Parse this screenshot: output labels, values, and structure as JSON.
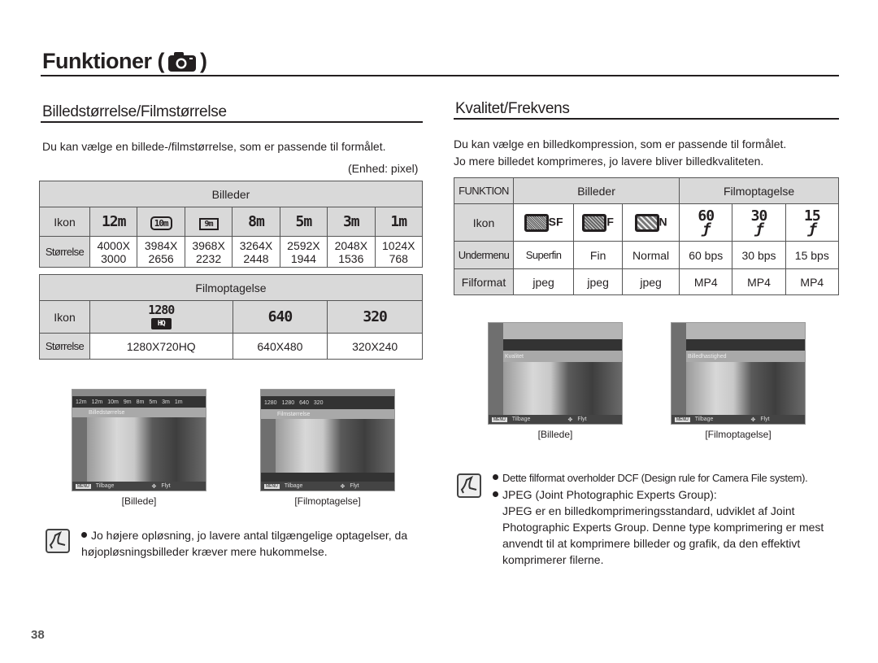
{
  "page": {
    "title": "Funktioner (",
    "title_close": ")",
    "title_icon": "camera-icon",
    "page_number": "38"
  },
  "left": {
    "section_title": "Billedstørrelse/Filmstørrelse",
    "intro": "Du kan vælge en billede-/filmstørrelse, som er passende til formålet.",
    "unit": "(Enhed: pixel)",
    "image_table": {
      "header": "Billeder",
      "icon_label": "Ikon",
      "size_label": "Størrelse",
      "icons": [
        "12m",
        "10m",
        "9m",
        "8m",
        "5m",
        "3m",
        "1m"
      ],
      "sizes": [
        [
          "4000X",
          "3000"
        ],
        [
          "3984X",
          "2656"
        ],
        [
          "3968X",
          "2232"
        ],
        [
          "3264X",
          "2448"
        ],
        [
          "2592X",
          "1944"
        ],
        [
          "2048X",
          "1536"
        ],
        [
          "1024X",
          "768"
        ]
      ]
    },
    "movie_table": {
      "header": "Filmoptagelse",
      "icon_label": "Ikon",
      "size_label": "Størrelse",
      "icons": [
        "1280 HQ",
        "640",
        "320"
      ],
      "sizes": [
        "1280X720HQ",
        "640X480",
        "320X240"
      ]
    },
    "screenshots": [
      {
        "caption": "[Billede]",
        "menu": "Billedstørrelse",
        "options": [
          "12m",
          "12m",
          "10m",
          "9m",
          "8m",
          "5m",
          "3m",
          "1m"
        ],
        "back": "Tilbage",
        "move": "Flyt",
        "menu_key": "MENU"
      },
      {
        "caption": "[Filmoptagelse]",
        "menu": "Filmstørrelse",
        "options": [
          "1280",
          "1280",
          "640",
          "320"
        ],
        "back": "Tilbage",
        "move": "Flyt",
        "menu_key": "MENU"
      }
    ],
    "note": "Jo højere opløsning, jo lavere antal tilgængelige optagelser, da højopløsningsbilleder kræver mere hukommelse."
  },
  "right": {
    "section_title": "Kvalitet/Frekvens",
    "intro_line1": "Du kan vælge en billedkompression, som er passende til formålet.",
    "intro_line2": "Jo mere billedet komprimeres, jo lavere bliver billedkvaliteten.",
    "table": {
      "funktion_label": "FUNKTION",
      "image_header": "Billeder",
      "movie_header": "Filmoptagelse",
      "icon_label": "Ikon",
      "submenu_label": "Undermenu",
      "format_label": "Filformat",
      "icons": [
        "SF",
        "F",
        "N",
        "60",
        "30",
        "15"
      ],
      "submenus": [
        "Superfin",
        "Fin",
        "Normal",
        "60 bps",
        "30 bps",
        "15 bps"
      ],
      "formats": [
        "jpeg",
        "jpeg",
        "jpeg",
        "MP4",
        "MP4",
        "MP4"
      ]
    },
    "screenshots": [
      {
        "caption": "[Billede]",
        "menu": "Kvalitet",
        "back": "Tilbage",
        "move": "Flyt",
        "menu_key": "MENU"
      },
      {
        "caption": "[Filmoptagelse]",
        "menu": "Billedhastighed",
        "back": "Tilbage",
        "move": "Flyt",
        "menu_key": "MENU"
      }
    ],
    "notes": [
      "Dette filformat overholder DCF (Design rule for Camera File system).",
      "JPEG (Joint Photographic Experts Group):"
    ],
    "note_detail": "JPEG er en billedkomprimeringsstandard, udviklet af Joint Photographic Experts Group. Denne type komprimering er mest anvendt til at komprimere billeder og grafik, da den effektivt komprimerer filerne."
  }
}
